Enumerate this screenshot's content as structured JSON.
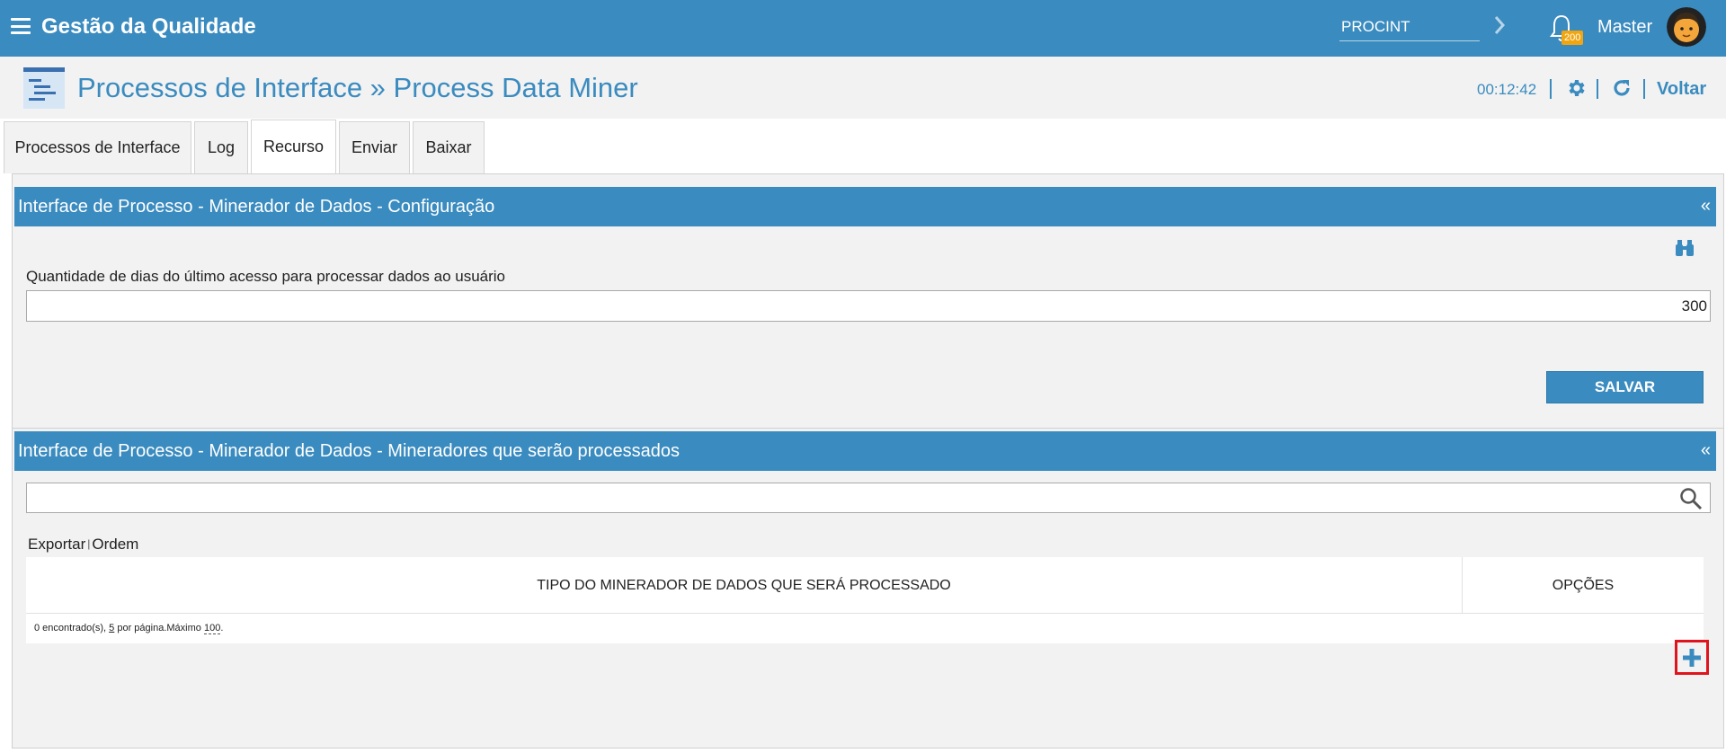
{
  "topbar": {
    "app_title": "Gestão da Qualidade",
    "context_value": "PROCINT",
    "notifications_count": "200",
    "user_name": "Master"
  },
  "header": {
    "page_title": "Processos de Interface » Process Data Miner",
    "timer": "00:12:42",
    "back_label": "Voltar"
  },
  "tabs": [
    {
      "label": "Processos de Interface",
      "active": false
    },
    {
      "label": "Log",
      "active": false
    },
    {
      "label": "Recurso",
      "active": true
    },
    {
      "label": "Enviar",
      "active": false
    },
    {
      "label": "Baixar",
      "active": false
    }
  ],
  "config_section": {
    "title": "Interface de Processo - Minerador de Dados - Configuração",
    "collapse_label": "«",
    "field_label": "Quantidade de dias do último acesso para processar dados ao usuário",
    "field_value": "300",
    "save_label": "SALVAR"
  },
  "miners_section": {
    "title": "Interface de Processo - Minerador de Dados - Mineradores que serão processados",
    "collapse_label": "«",
    "search_value": "",
    "export_label": "Exportar",
    "order_label": "Ordem",
    "table": {
      "columns": [
        "TIPO DO MINERADOR DE DADOS QUE SERÁ PROCESSADO",
        "OPÇÕES"
      ],
      "rows": [],
      "footer": {
        "found_text": "0 encontrado(s), ",
        "per_page_value": "5",
        "per_page_text": " por página.Máximo ",
        "max_value": "100",
        "end_text": "."
      }
    }
  },
  "colors": {
    "primary": "#3a8bbf",
    "badge": "#f1a511",
    "highlight": "#e0141e"
  }
}
